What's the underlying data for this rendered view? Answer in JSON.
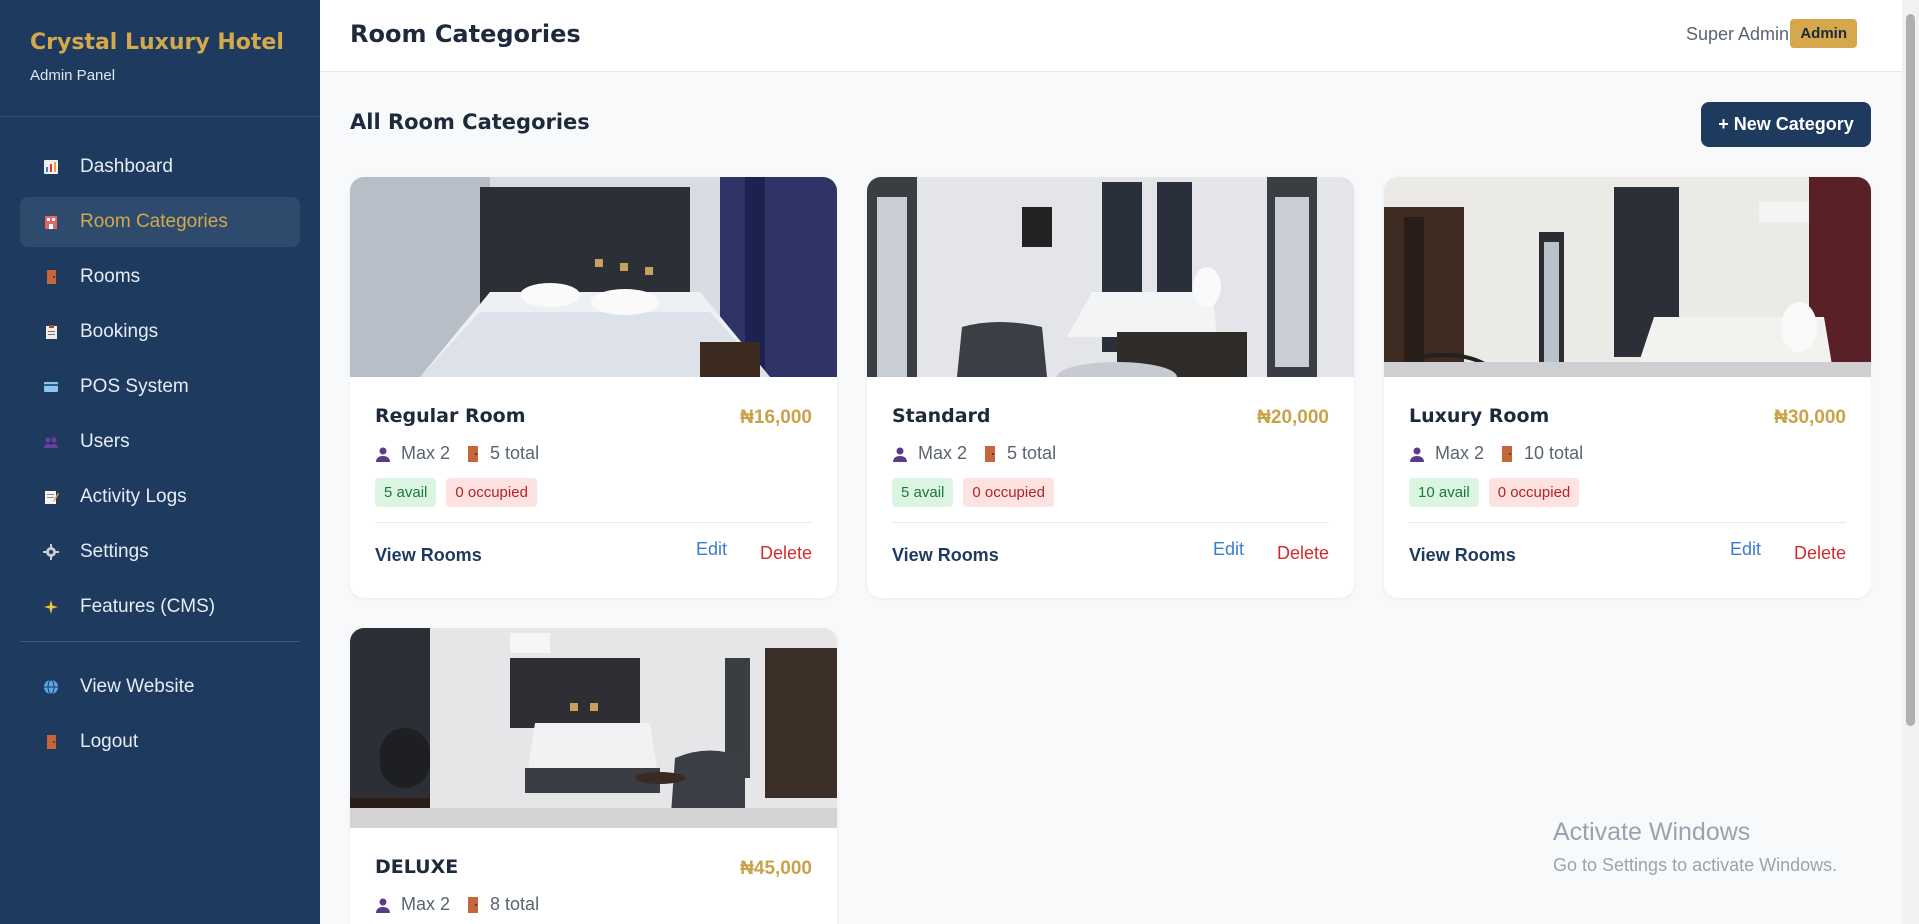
{
  "sidebar": {
    "brand_title": "Crystal Luxury Hotel",
    "brand_sub": "Admin Panel",
    "items": [
      {
        "label": "Dashboard",
        "icon": "chart-icon"
      },
      {
        "label": "Room Categories",
        "icon": "hotel-icon",
        "active": true
      },
      {
        "label": "Rooms",
        "icon": "door-icon"
      },
      {
        "label": "Bookings",
        "icon": "clipboard-icon"
      },
      {
        "label": "POS System",
        "icon": "card-icon"
      },
      {
        "label": "Users",
        "icon": "users-icon"
      },
      {
        "label": "Activity Logs",
        "icon": "memo-icon"
      },
      {
        "label": "Settings",
        "icon": "gear-icon"
      },
      {
        "label": "Features (CMS)",
        "icon": "sparkle-icon"
      }
    ],
    "footer_items": [
      {
        "label": "View Website",
        "icon": "globe-icon"
      },
      {
        "label": "Logout",
        "icon": "door-icon"
      }
    ]
  },
  "header": {
    "title": "Room Categories",
    "user_name": "Super Admin",
    "role": "Admin"
  },
  "main": {
    "section_title": "All Room Categories",
    "new_button": "+ New Category",
    "cards": [
      {
        "name": "Regular Room",
        "price": "₦16,000",
        "max": "Max 2",
        "total": "5 total",
        "avail": "5 avail",
        "occupied": "0 occupied",
        "view": "View Rooms",
        "edit": "Edit",
        "delete": "Delete"
      },
      {
        "name": "Standard",
        "price": "₦20,000",
        "max": "Max 2",
        "total": "5 total",
        "avail": "5 avail",
        "occupied": "0 occupied",
        "view": "View Rooms",
        "edit": "Edit",
        "delete": "Delete"
      },
      {
        "name": "Luxury Room",
        "price": "₦30,000",
        "max": "Max 2",
        "total": "10 total",
        "avail": "10 avail",
        "occupied": "0 occupied",
        "view": "View Rooms",
        "edit": "Edit",
        "delete": "Delete"
      },
      {
        "name": "DELUXE",
        "price": "₦45,000",
        "max": "Max 2",
        "total": "8 total"
      }
    ]
  },
  "watermark": {
    "line1": "Activate Windows",
    "line2": "Go to Settings to activate Windows."
  },
  "colors": {
    "sidebar_bg": "#1e3a5f",
    "accent_gold": "#d4a84b",
    "avail_green": "#1a7a3c",
    "occupied_red": "#b42323"
  }
}
